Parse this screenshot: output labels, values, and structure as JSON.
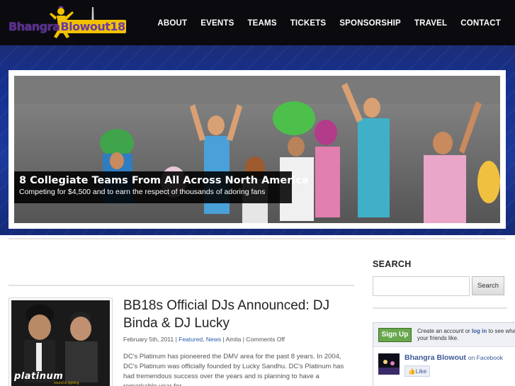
{
  "brand": {
    "name_part1": "Bhangra",
    "name_part2": "Blowout18",
    "accent": "#5a2d91",
    "highlight": "#f2c200"
  },
  "nav": {
    "items": [
      "ABOUT",
      "EVENTS",
      "TEAMS",
      "TICKETS",
      "SPONSORSHIP",
      "TRAVEL",
      "CONTACT"
    ]
  },
  "slider": {
    "caption_title": "8 Collegiate Teams From All Across North America",
    "caption_subtitle": "Competing for $4,500 and to earn the respect of thousands of adoring fans"
  },
  "post": {
    "title": "BB18s Official DJs Announced: DJ Binda & DJ Lucky",
    "date": "February 5th, 2011",
    "category1": "Featured",
    "category2": "News",
    "author": "Amita",
    "comments": "Comments Off",
    "excerpt": "DC's Platinum has pioneered the DMV area for the past 8 years. In 2004, DC's Platinum was officially founded by Lucky Sandhu. DC's Platinum has had tremendous success over the years and is planning to have a remarkable year for",
    "thumb_logo": "platinum",
    "thumb_tagline": "sound & lighting"
  },
  "sidebar": {
    "search_title": "SEARCH",
    "search_placeholder": "",
    "search_button": "Search",
    "fb": {
      "signup_label": "Sign Up",
      "prompt_text_before": "Create an account or ",
      "login_label": "log in",
      "prompt_text_after": " to see what your friends like.",
      "page_name": "Bhangra Blowout",
      "on_facebook": "on Facebook",
      "like_label": "Like"
    }
  },
  "colors": {
    "header_bg": "#0b0b0f",
    "band_bg": "#1a3490",
    "link": "#2a5db0",
    "fb_blue": "#3b5998",
    "fb_green": "#69a74e"
  }
}
